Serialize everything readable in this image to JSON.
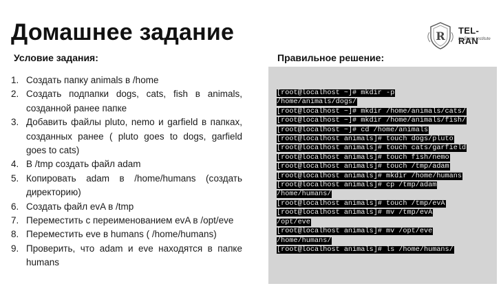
{
  "header": {
    "title": "Домашнее задание",
    "logo": {
      "name": "TEL-RAN",
      "subtitle": "by Starta Institute"
    }
  },
  "condition": {
    "title": "Условие задания:",
    "items": [
      {
        "num": "1.",
        "text": "Создать папку animals в /home"
      },
      {
        "num": "2.",
        "text": "Создать подпапки dogs, cats, fish в animals, созданной ранее папке"
      },
      {
        "num": "3.",
        "text": "Добавить файлы pluto, nemo и garfield в папках, созданных ранее ( pluto goes to dogs, garfield goes to cats)"
      },
      {
        "num": "4.",
        "text": "В /tmp создать файл adam"
      },
      {
        "num": "5.",
        "text": "Копировать adam в /home/humans (создать директорию)"
      },
      {
        "num": "6.",
        "text": "Создать файл evA в /tmp"
      },
      {
        "num": "7.",
        "text": "Переместить с переименованием evA в /opt/eve"
      },
      {
        "num": "8.",
        "text": "Переместить eve в humans ( /home/humans)"
      },
      {
        "num": "9.",
        "text": "Проверить, что adam и eve находятся в папке humans"
      }
    ]
  },
  "solution": {
    "title": "Правильное решение:",
    "lines": [
      "[root@localhost ~]# mkdir -p",
      "/home/animals/dogs/",
      "[root@localhost ~]# mkdir /home/animals/cats/",
      "[root@localhost ~]# mkdir /home/animals/fish/",
      "[root@localhost ~]# cd /home/animals",
      "[root@localhost animals]# touch dogs/pluto",
      "[root@localhost animals]# touch cats/garfield",
      "[root@localhost animals]# touch fish/nemo",
      "[root@localhost animals]# touch /tmp/adam",
      "[root@localhost animals]# mkdir /home/humans",
      "[root@localhost animals]# cp /tmp/adam",
      "/home/humans/",
      "[root@localhost animals]# touch /tmp/evA",
      "[root@localhost animals]# mv /tmp/evA",
      "/opt/eve",
      "[root@localhost animals]# mv /opt/eve",
      "/home/humans/",
      "[root@localhost animals]# ls /home/humans/"
    ]
  },
  "colors": {
    "panel": "#d4d4d4",
    "terminal_bg": "#000000",
    "terminal_text": "#f2f2f2"
  }
}
